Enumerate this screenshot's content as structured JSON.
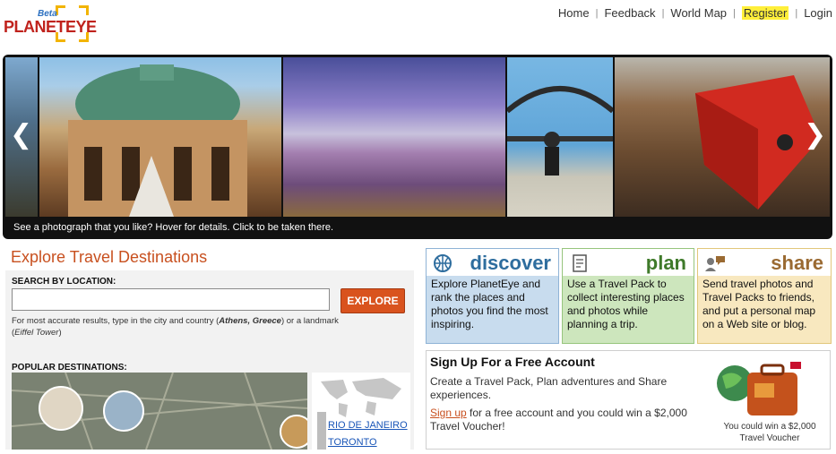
{
  "logo": {
    "beta": "Beta",
    "name": "PLANETEYE"
  },
  "nav": {
    "home": "Home",
    "feedback": "Feedback",
    "world_map": "World Map",
    "register": "Register",
    "login": "Login",
    "separator": "|"
  },
  "slideshow": {
    "caption": "See a photograph that you like? Hover for details. Click to be taken there.",
    "prev": "❮",
    "next": "❯"
  },
  "explore": {
    "title": "Explore Travel Destinations",
    "search_label": "SEARCH BY LOCATION:",
    "search_value": "",
    "button": "EXPLORE",
    "hint_pre": "For most accurate results, type in the city and country (",
    "hint_city": "Athens, Greece",
    "hint_mid": ") or a landmark (",
    "hint_landmark": "Eiffel Tower",
    "hint_post": ")",
    "popular_label": "POPULAR DESTINATIONS:",
    "destinations": [
      "RIO DE JANEIRO",
      "TORONTO"
    ]
  },
  "features": {
    "discover": {
      "title": "discover",
      "text": "Explore PlanetEye and rank the places and photos you find the most inspiring.",
      "color": "#2e6d9e",
      "bg": "#c8dcee"
    },
    "plan": {
      "title": "plan",
      "text": "Use a Travel Pack to collect interesting places and photos while planning a trip.",
      "color": "#3f7a2a",
      "bg": "#cde6bd"
    },
    "share": {
      "title": "share",
      "text": "Send travel photos and Travel Packs to friends, and put a personal map on a Web site or blog.",
      "color": "#9a6a32",
      "bg": "#f8e8bf"
    }
  },
  "signup": {
    "title": "Sign Up For a Free Account",
    "text": "Create a Travel Pack, Plan adventures and Share experiences.",
    "link": "Sign up",
    "text2": " for a free account and you could win a $2,000 Travel Voucher!",
    "win": "You could win a $2,000 Travel Voucher"
  }
}
